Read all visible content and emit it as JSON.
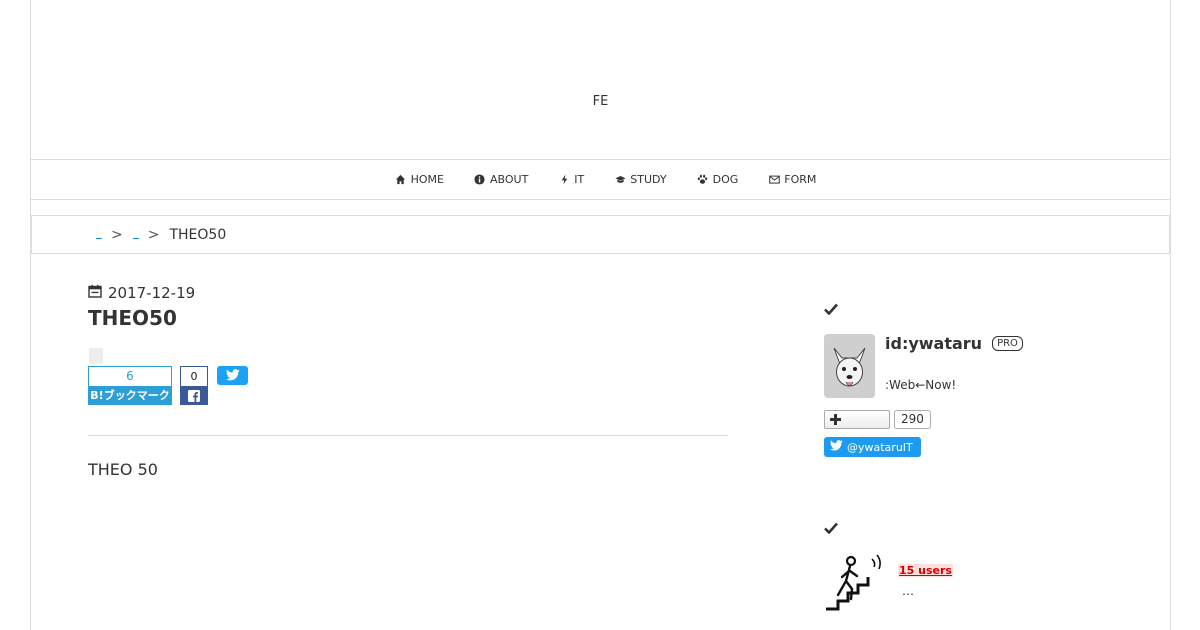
{
  "header": {
    "site_title": "FE"
  },
  "nav": [
    {
      "label": "HOME",
      "icon": "home-icon"
    },
    {
      "label": "ABOUT",
      "icon": "info-icon"
    },
    {
      "label": "IT",
      "icon": "bolt-icon"
    },
    {
      "label": "STUDY",
      "icon": "graduation-cap-icon"
    },
    {
      "label": "DOG",
      "icon": "paw-icon"
    },
    {
      "label": "FORM",
      "icon": "envelope-icon"
    }
  ],
  "breadcrumb": {
    "separator": ">",
    "current": "THEO50"
  },
  "entry": {
    "date": "2017-12-19",
    "title": "THEO50",
    "body": "THEO 50",
    "share": {
      "hatena_count": "6",
      "hatena_label": "B!ブックマーク",
      "facebook_count": "0"
    }
  },
  "sidebar": {
    "profile": {
      "id": "id:ywataru",
      "badge": "PRO",
      "description": ":Web←Now!",
      "follow_count": "290",
      "twitter_handle": "@ywataruIT"
    },
    "entry": {
      "users": "15 users",
      "snippet": "…"
    }
  },
  "colors": {
    "hatena": "#2c9fd6",
    "facebook": "#3b5998",
    "twitter": "#1da1f2",
    "users_badge": "#d40000"
  }
}
